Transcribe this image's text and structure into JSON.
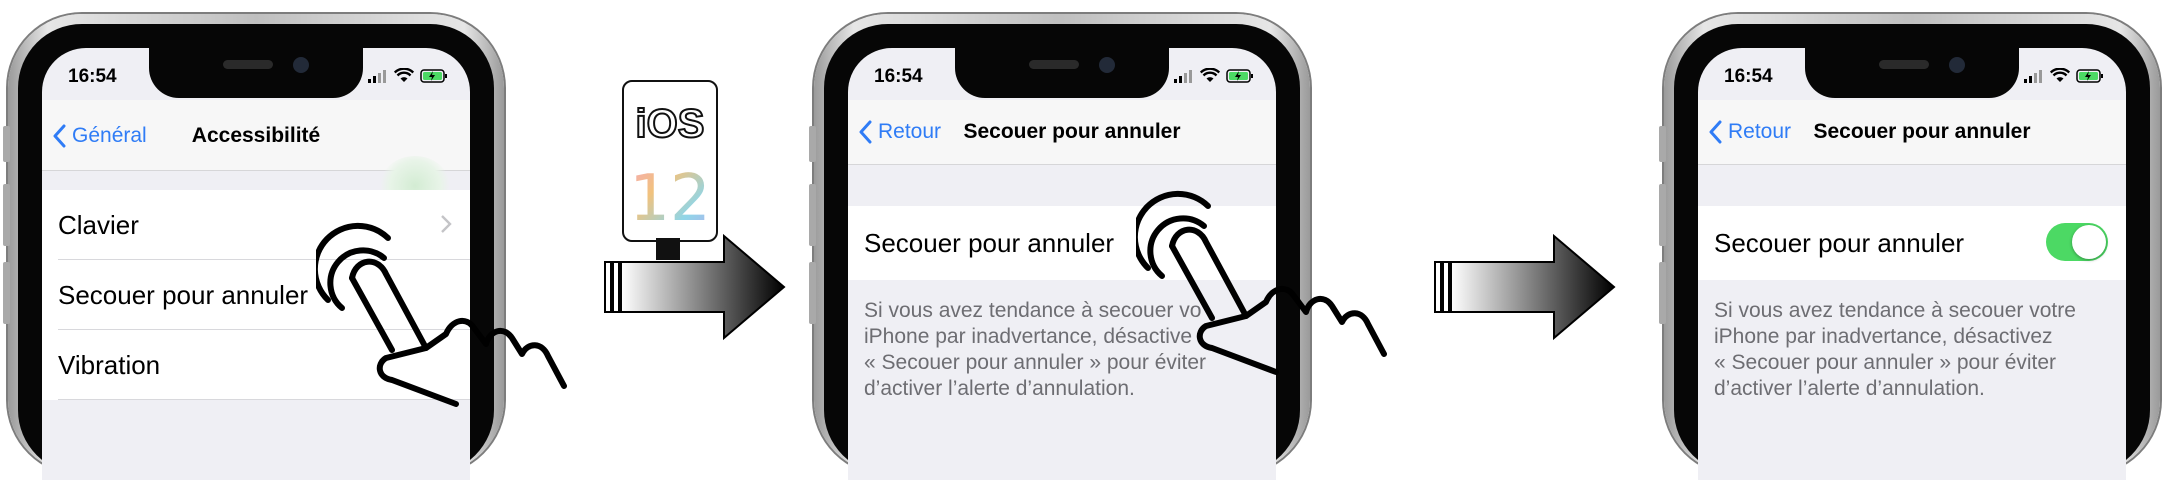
{
  "status": {
    "time": "16:54"
  },
  "screen1": {
    "nav": {
      "back": "Général",
      "title": "Accessibilité"
    },
    "cells": [
      {
        "label": "Clavier"
      },
      {
        "label": "Secouer pour annuler"
      },
      {
        "label": "Vibration"
      }
    ]
  },
  "screen2": {
    "nav": {
      "back": "Retour",
      "title": "Secouer pour annuler"
    },
    "cell": {
      "label": "Secouer pour annuler"
    },
    "footer": [
      "Si vous avez tendance à secouer vo",
      "iPhone par inadvertance, désactive",
      "« Secouer pour annuler » pour éviter",
      "d’activer l’alerte d’annulation."
    ]
  },
  "screen3": {
    "nav": {
      "back": "Retour",
      "title": "Secouer pour annuler"
    },
    "cell": {
      "label": "Secouer pour annuler",
      "toggle_on": true
    },
    "footer": [
      "Si vous avez tendance à secouer votre",
      "iPhone par inadvertance, désactivez",
      "« Secouer pour annuler » pour éviter",
      "d’activer l’alerte d’annulation."
    ]
  },
  "badge": {
    "os": "iOS",
    "version": "12"
  },
  "colors": {
    "accent": "#2f7cf6",
    "toggle_on": "#4cd964",
    "footer_text": "#6d6d72"
  }
}
